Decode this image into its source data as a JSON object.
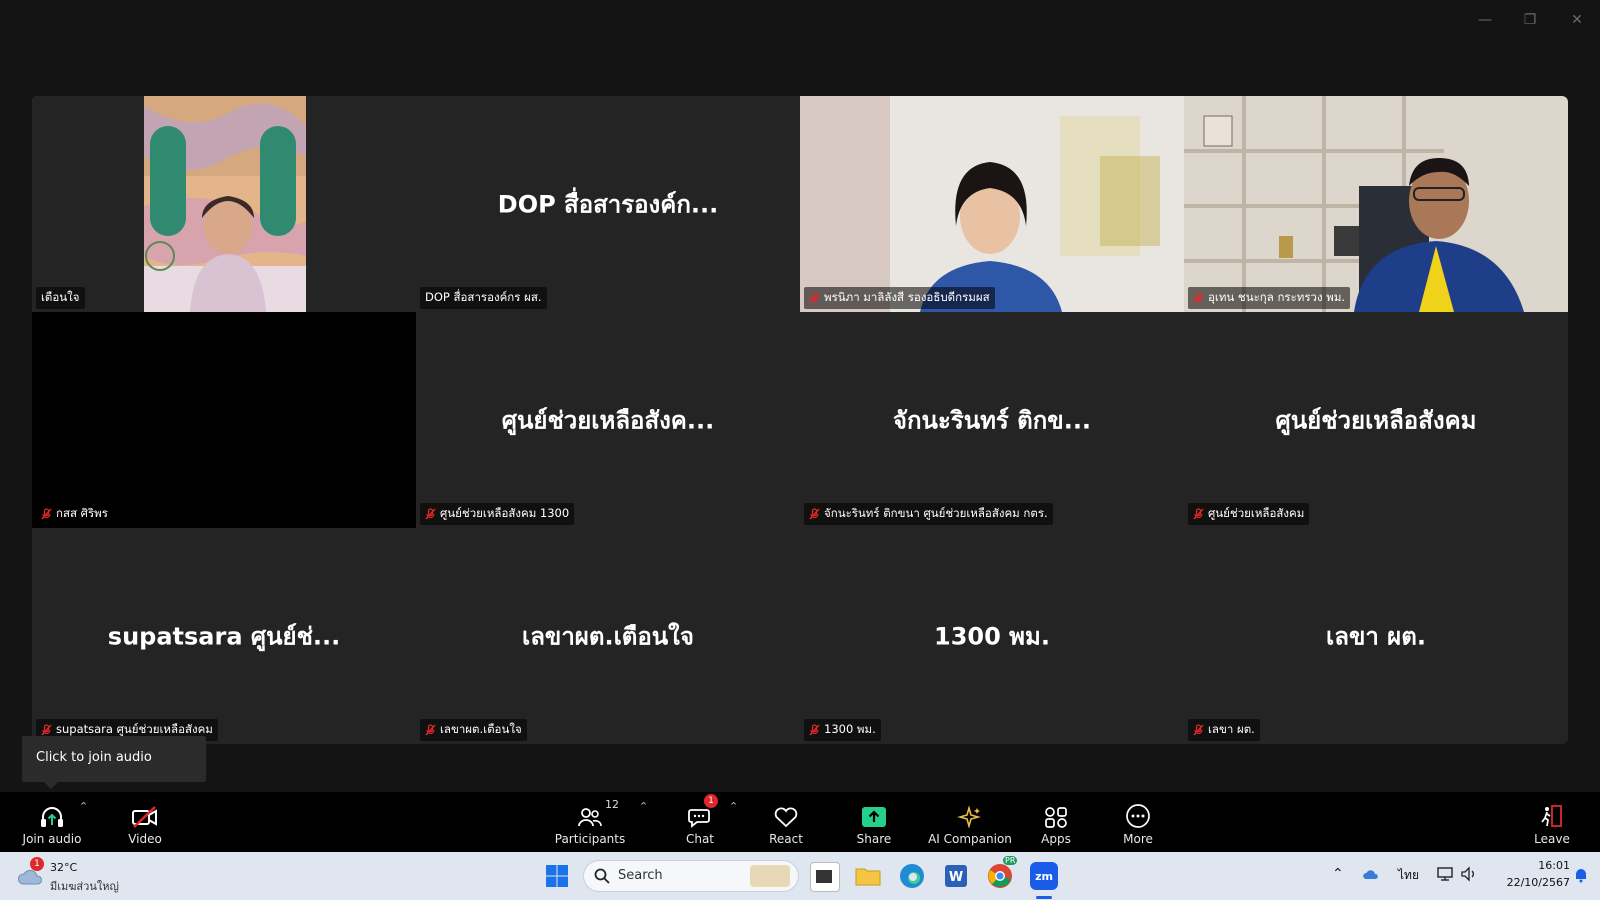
{
  "window": {
    "minimize": "—",
    "restore": "❐",
    "close": "✕"
  },
  "tiles": [
    {
      "name": "เตือนใจ",
      "big": "",
      "muted": false,
      "type": "video-woman-painting"
    },
    {
      "name": "DOP สื่อสารองค์กร ผส.",
      "big": "DOP สื่อสารองค์ก...",
      "muted": false,
      "type": "text"
    },
    {
      "name": "พรนิภา มาลิลังสี รองอธิบดีกรมผส",
      "big": "",
      "muted": true,
      "type": "video-woman-office"
    },
    {
      "name": "อุเทน ชนะกุล กระทรวง พม.",
      "big": "",
      "muted": true,
      "type": "video-man-shelf"
    },
    {
      "name": "กสส ศิริพร",
      "big": "",
      "muted": true,
      "type": "black"
    },
    {
      "name": "ศูนย์ช่วยเหลือสังคม 1300",
      "big": "ศูนย์ช่วยเหลือสังค...",
      "muted": true,
      "type": "text"
    },
    {
      "name": "จักนะรินทร์ ติกขนา ศูนย์ช่วยเหลือสังคม กตร.",
      "big": "จักนะรินทร์ ติกข...",
      "muted": true,
      "type": "text"
    },
    {
      "name": "ศูนย์ช่วยเหลือสังคม",
      "big": "ศูนย์ช่วยเหลือสังคม",
      "muted": true,
      "type": "text"
    },
    {
      "name": "supatsara ศูนย์ช่วยเหลือสังคม",
      "big": "supatsara ศูนย์ช่...",
      "muted": true,
      "type": "text"
    },
    {
      "name": "เลขาผต.เตือนใจ",
      "big": "เลขาผต.เตือนใจ",
      "muted": true,
      "type": "text"
    },
    {
      "name": "1300 พม.",
      "big": "1300 พม.",
      "muted": true,
      "type": "text"
    },
    {
      "name": "เลขา ผต.",
      "big": "เลขา ผต.",
      "muted": true,
      "type": "text"
    }
  ],
  "tooltip": {
    "text": "Click to join audio"
  },
  "toolbar": {
    "join_audio": "Join audio",
    "video": "Video",
    "participants": "Participants",
    "participants_count": "12",
    "chat": "Chat",
    "chat_badge": "1",
    "react": "React",
    "share": "Share",
    "ai_companion": "AI Companion",
    "apps": "Apps",
    "more": "More",
    "leave": "Leave"
  },
  "taskbar": {
    "weather_temp": "32°C",
    "weather_desc": "มีเมฆส่วนใหญ่",
    "weather_badge": "1",
    "search_placeholder": "Search",
    "language": "ไทย",
    "time": "16:01",
    "date": "22/10/2567",
    "zoom_badge": "PR"
  },
  "colors": {
    "active_speaker": "#23d18b",
    "mute_red": "#e02828",
    "share_green": "#23d18b"
  }
}
